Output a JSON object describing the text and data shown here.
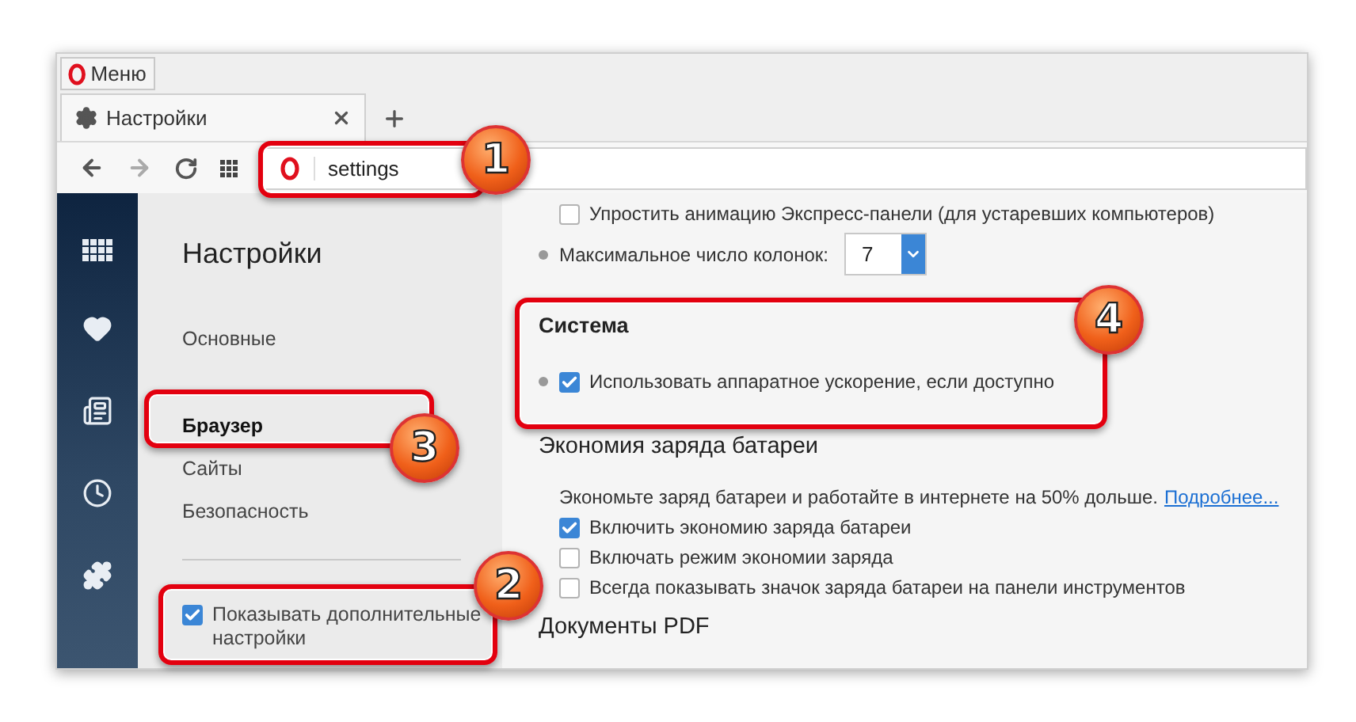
{
  "menu_button": {
    "label": "Меню"
  },
  "tabs": [
    {
      "label": "Настройки",
      "selected": true
    }
  ],
  "address_bar": {
    "value": "settings"
  },
  "sidebar": {
    "title": "Настройки",
    "items": [
      {
        "label": "Основные",
        "selected": false
      },
      {
        "label": "Браузер",
        "selected": true
      },
      {
        "label": "Сайты",
        "selected": false
      },
      {
        "label": "Безопасность",
        "selected": false
      }
    ],
    "advanced": {
      "label": "Показывать дополнительные настройки",
      "checked": true
    }
  },
  "sections": [
    {
      "rows": [
        {
          "kind": "checkbox",
          "label": "Упростить анимацию Экспресс-панели (для устаревших компьютеров)",
          "checked": false,
          "bullet": false
        },
        {
          "kind": "select",
          "label": "Максимальное число колонок:",
          "value": "7",
          "bullet": true
        }
      ]
    },
    {
      "title": "Система",
      "rows": [
        {
          "kind": "checkbox",
          "label": "Использовать аппаратное ускорение, если доступно",
          "checked": true,
          "bullet": true
        }
      ]
    },
    {
      "title": "Экономия заряда батареи",
      "rows": [
        {
          "kind": "text",
          "label": "Экономьте заряд батареи и работайте в интернете на 50% дольше.",
          "link": "Подробнее...",
          "bullet": false
        },
        {
          "kind": "checkbox",
          "label": "Включить экономию заряда батареи",
          "checked": true,
          "bullet": false
        },
        {
          "kind": "checkbox",
          "label": "Включать режим экономии заряда",
          "checked": false,
          "bullet": false
        },
        {
          "kind": "checkbox",
          "label": "Всегда показывать значок заряда батареи на панели инструментов",
          "checked": false,
          "bullet": false
        }
      ]
    },
    {
      "title": "Документы PDF"
    }
  ],
  "annotations": [
    {
      "number": "1"
    },
    {
      "number": "2"
    },
    {
      "number": "3"
    },
    {
      "number": "4"
    }
  ]
}
